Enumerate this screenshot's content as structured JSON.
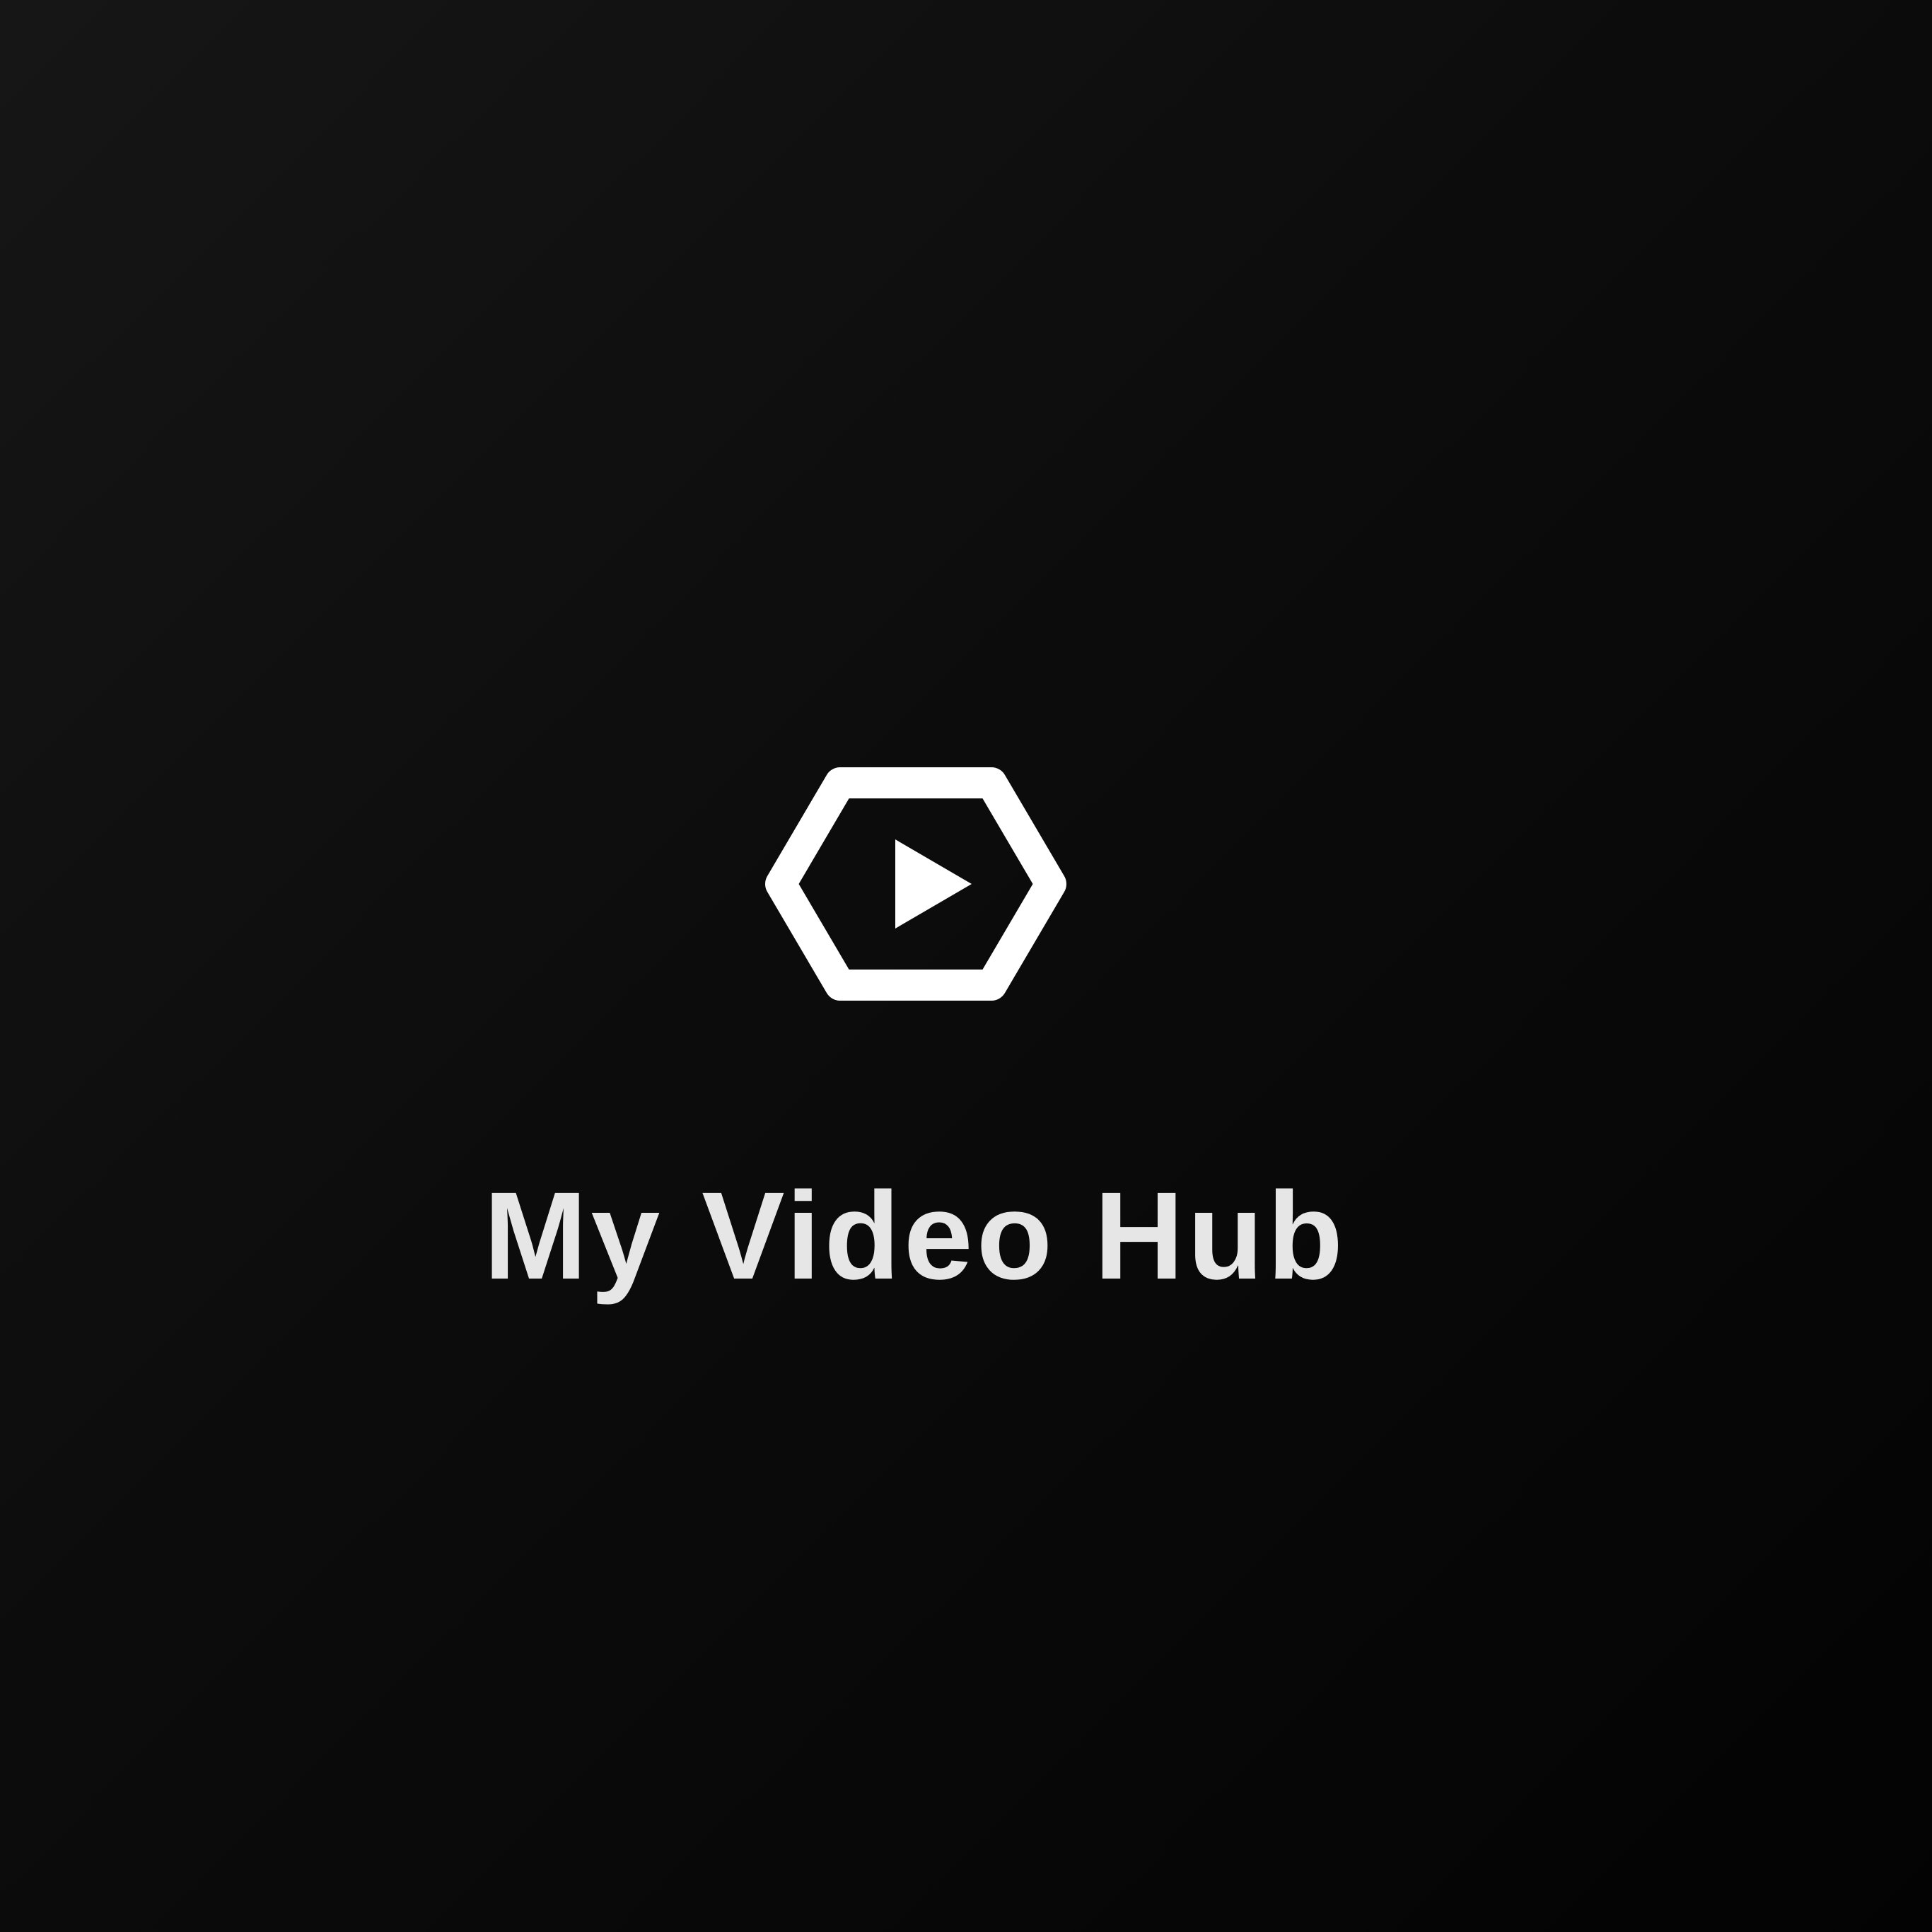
{
  "app": {
    "title": "My Video Hub",
    "logo_icon": "hexagon-play-icon"
  },
  "colors": {
    "background_start": "#161616",
    "background_end": "#030303",
    "logo": "#ffffff",
    "title": "#e6e6e6"
  }
}
